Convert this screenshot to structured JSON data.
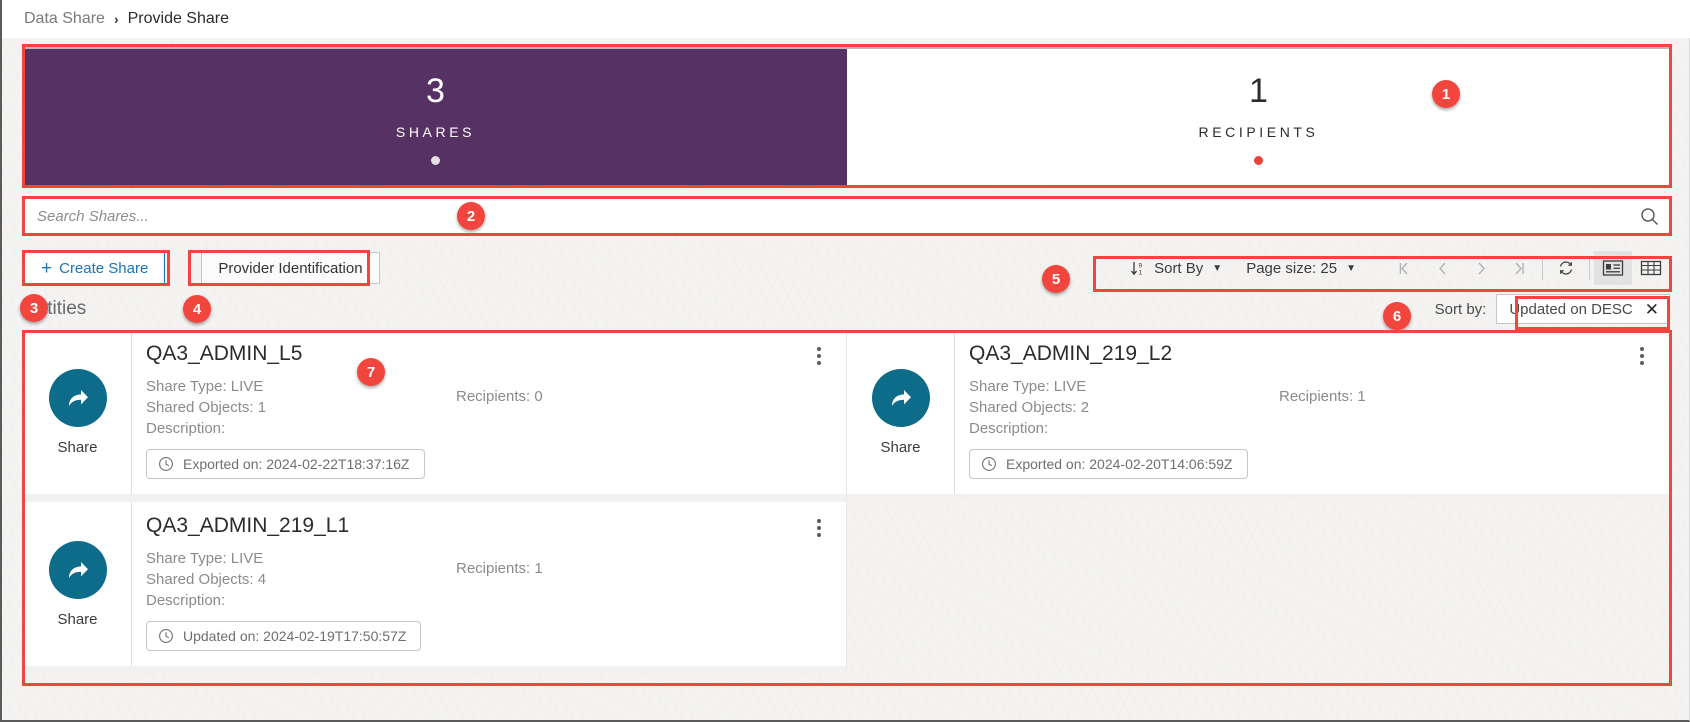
{
  "breadcrumb": {
    "root": "Data Share",
    "separator": "›",
    "current": "Provide Share"
  },
  "kpis": [
    {
      "value": "3",
      "label": "SHARES",
      "style": "purple",
      "dot_color": "#e3dfe4"
    },
    {
      "value": "1",
      "label": "RECIPIENTS",
      "style": "white",
      "dot_color": "#e8443a"
    }
  ],
  "search": {
    "placeholder": "Search Shares...",
    "value": "",
    "icon": "search-icon"
  },
  "toolbar": {
    "create_share_label": "Create Share",
    "create_share_plus": "+",
    "provider_identification_label": "Provider Identification",
    "sort_by_label": "Sort By",
    "page_size_label": "Page size: 25",
    "caret": "▼",
    "pager": {
      "first": "|‹",
      "prev": "‹",
      "next": "›",
      "last": "›|"
    },
    "refresh_icon": "refresh-icon",
    "card_view_icon": "card-view-icon",
    "table_view_icon": "table-view-icon"
  },
  "entities": {
    "title": "Entities",
    "sort_by_label": "Sort by:",
    "sort_chip": "Updated on DESC",
    "chip_close": "✕"
  },
  "cards": [
    {
      "avatar_label": "Share",
      "title": "QA3_ADMIN_L5",
      "share_type": "Share Type: LIVE",
      "shared_objects": "Shared Objects: 1",
      "description": "Description:",
      "recipients": "Recipients: 0",
      "timestamp": "Exported on: 2024-02-22T18:37:16Z",
      "menu_icon": "kebab-menu-icon"
    },
    {
      "avatar_label": "Share",
      "title": "QA3_ADMIN_219_L2",
      "share_type": "Share Type: LIVE",
      "shared_objects": "Shared Objects: 2",
      "description": "Description:",
      "recipients": "Recipients: 1",
      "timestamp": "Exported on: 2024-02-20T14:06:59Z",
      "menu_icon": "kebab-menu-icon"
    },
    {
      "avatar_label": "Share",
      "title": "QA3_ADMIN_219_L1",
      "share_type": "Share Type: LIVE",
      "shared_objects": "Shared Objects: 4",
      "description": "Description:",
      "recipients": "Recipients: 1",
      "timestamp": "Updated on: 2024-02-19T17:50:57Z",
      "menu_icon": "kebab-menu-icon"
    }
  ],
  "annotations": [
    {
      "number": "1"
    },
    {
      "number": "2"
    },
    {
      "number": "3"
    },
    {
      "number": "4"
    },
    {
      "number": "5"
    },
    {
      "number": "6"
    },
    {
      "number": "7"
    }
  ],
  "colors": {
    "kpi_purple": "#563264",
    "accent_red": "#f2453d",
    "link_blue": "#1b74b8",
    "avatar_teal": "#0d6c8a"
  }
}
